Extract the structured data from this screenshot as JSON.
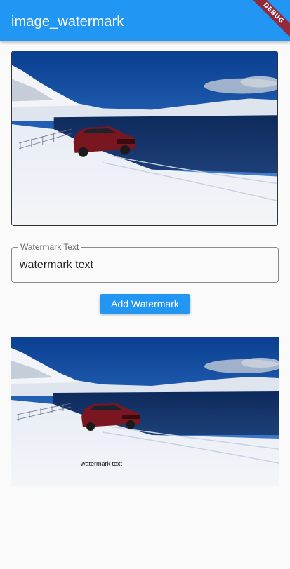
{
  "app_bar": {
    "title": "image_watermark",
    "background": "#2196f3"
  },
  "debug_banner": {
    "label": "DEBUG"
  },
  "source_image": {
    "description_icon": "photo-snow-car-lake"
  },
  "watermark_field": {
    "label": "Watermark Text",
    "value": "watermark text"
  },
  "add_button": {
    "label": "Add Watermark"
  },
  "result_image": {
    "watermark_text": "watermark text"
  },
  "colors": {
    "accent": "#2196f3",
    "background": "#fafafa"
  }
}
